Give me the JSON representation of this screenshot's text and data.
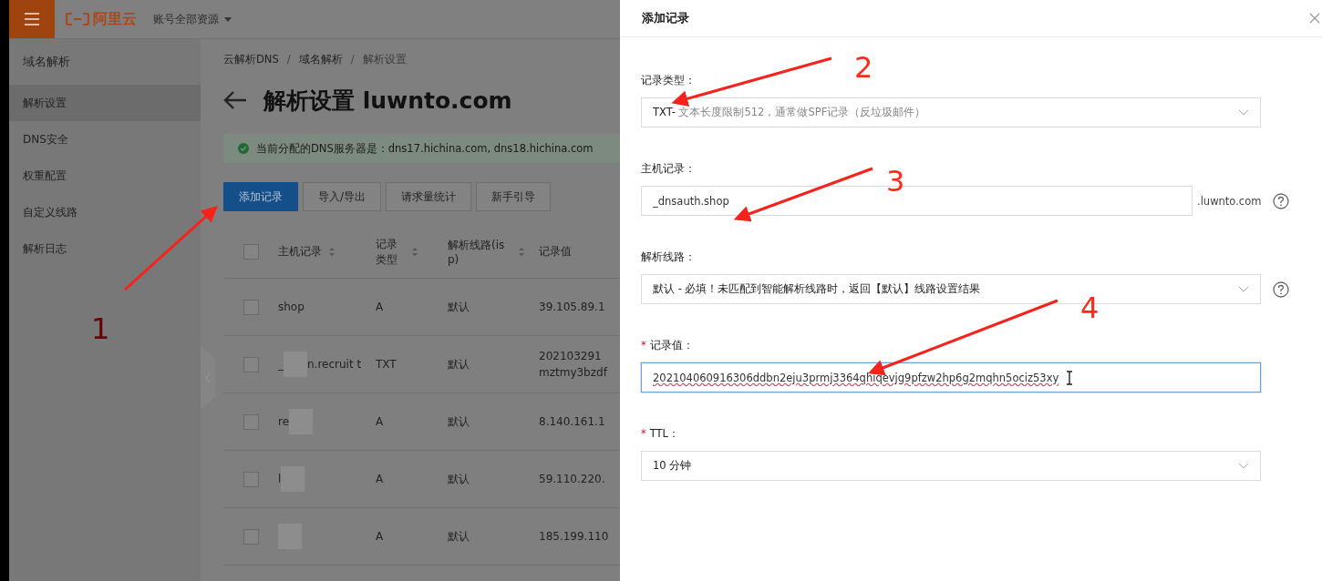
{
  "top_bar": {
    "logo": "阿里云",
    "account": "账号全部资源"
  },
  "sidebar": {
    "title": "域名解析",
    "items": [
      {
        "label": "解析设置",
        "selected": true
      },
      {
        "label": "DNS安全",
        "selected": false
      },
      {
        "label": "权重配置",
        "selected": false
      },
      {
        "label": "自定义线路",
        "selected": false
      },
      {
        "label": "解析日志",
        "selected": false
      }
    ]
  },
  "breadcrumb": [
    {
      "label": "云解析DNS",
      "separator": "/"
    },
    {
      "label": "域名解析",
      "separator": "/"
    },
    {
      "label": "解析设置"
    }
  ],
  "page_title": "解析设置 luwnto.com",
  "alert": "当前分配的DNS服务器是：dns17.hichina.com, dns18.hichina.com",
  "toolbar": [
    {
      "label": "添加记录",
      "primary": true
    },
    {
      "label": "导入/导出",
      "primary": false
    },
    {
      "label": "请求量统计",
      "primary": false
    },
    {
      "label": "新手引导",
      "primary": false
    }
  ],
  "table": {
    "select_all_checked": false,
    "columns": [
      {
        "label": "主机记录",
        "sortable": true
      },
      {
        "label": "记录类型",
        "sortable": true
      },
      {
        "label": "解析线路(isp)",
        "sortable": true
      },
      {
        "label": "记录值",
        "sortable": false
      }
    ],
    "rows": [
      {
        "checked": false,
        "host": "shop",
        "redacted": false,
        "type": "A",
        "line": "默认",
        "value": "39.105.89.1"
      },
      {
        "checked": false,
        "host": "_",
        "redacted": true,
        "host_after": "n.recruit t",
        "type": "TXT",
        "line": "默认",
        "value": "202103291 mztmy3bzdf"
      },
      {
        "checked": false,
        "host": "re",
        "redacted": true,
        "type": "A",
        "line": "默认",
        "value": "8.140.161.1"
      },
      {
        "checked": false,
        "host": "l",
        "redacted": true,
        "type": "A",
        "line": "默认",
        "value": "59.110.220."
      },
      {
        "checked": false,
        "redacted": true,
        "type": "A",
        "line": "默认",
        "value": "185.199.110"
      }
    ]
  },
  "drawer": {
    "title": "添加记录",
    "fields": [
      {
        "kind": "select",
        "label": "记录类型：",
        "value": "TXT-",
        "hint": "文本长度限制512，通常做SPF记录（反垃圾邮件）",
        "help": false
      },
      {
        "kind": "input",
        "label": "主机记录：",
        "value": "_dnsauth.shop",
        "suffix": ".luwnto.com",
        "help": true,
        "focused": false
      },
      {
        "kind": "select",
        "label": "解析线路：",
        "value": "默认 - 必填！未匹配到智能解析线路时，返回【默认】线路设置结果",
        "help": true
      },
      {
        "kind": "input",
        "required_mark": "*",
        "label": "记录值：",
        "value": "202104060916306ddbn2eju3prmj3364qhiqevjg9pfzw2hp6g2mqhn5ociz53xy",
        "help": false,
        "focused": true
      },
      {
        "kind": "select",
        "required_mark": "*",
        "label": "TTL：",
        "value": "10 分钟",
        "help": false
      }
    ]
  },
  "annotations": [
    {
      "label": "1"
    },
    {
      "label": "2"
    },
    {
      "label": "3"
    },
    {
      "label": "4"
    }
  ]
}
